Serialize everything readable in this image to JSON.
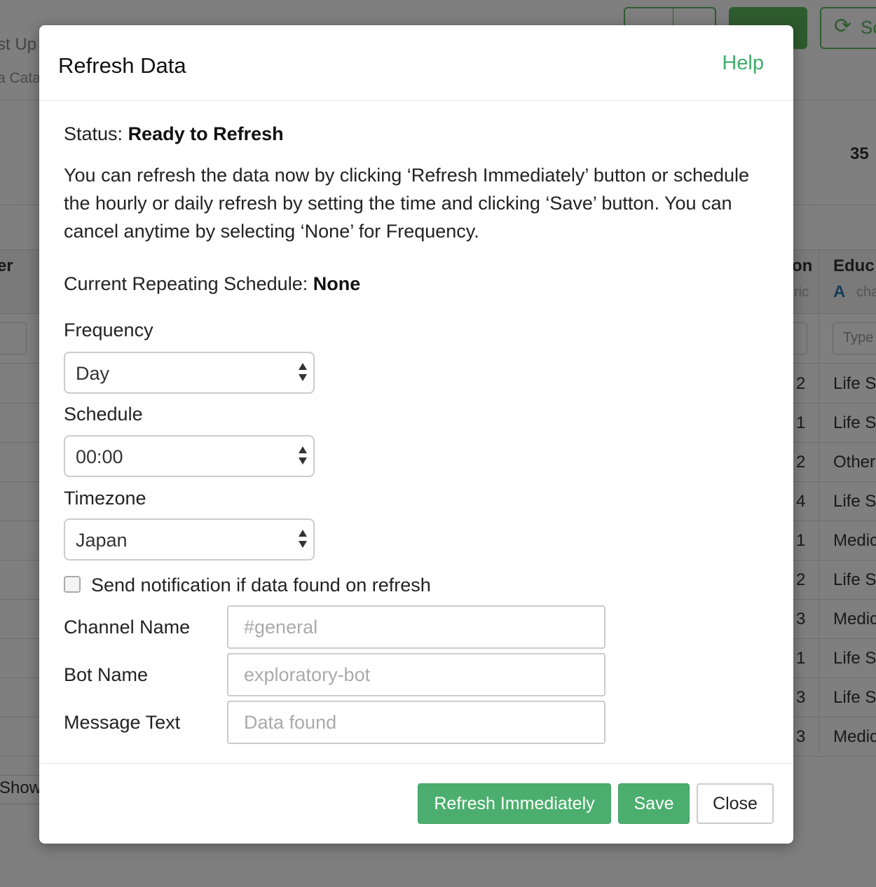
{
  "background": {
    "partial_texts": [
      "st Up",
      "a Cata",
      "35",
      "er",
      "on",
      "Educ",
      "ric",
      "A",
      "cha",
      "Type",
      "Show"
    ],
    "rows": [
      {
        "num": "2",
        "cat": "Life S"
      },
      {
        "num": "1",
        "cat": "Life S"
      },
      {
        "num": "2",
        "cat": "Other"
      },
      {
        "num": "4",
        "cat": "Life S"
      },
      {
        "num": "1",
        "cat": "Medic"
      },
      {
        "num": "2",
        "cat": "Life S"
      },
      {
        "num": "3",
        "cat": "Medic"
      },
      {
        "num": "1",
        "cat": "Life S"
      },
      {
        "num": "3",
        "cat": "Life S"
      },
      {
        "num": "3",
        "cat": "Medic"
      }
    ],
    "top_button_partial": "Sc",
    "colors": {
      "accent": "#5cb85c",
      "col_type_icon": "#337ab7"
    }
  },
  "modal": {
    "title": "Refresh Data",
    "help_label": "Help",
    "status_label": "Status:",
    "status_value": "Ready to Refresh",
    "description": "You can refresh the data now by clicking ‘Refresh Immediately’ button or schedule the hourly or daily refresh by setting the time and clicking ‘Save’ button. You can cancel anytime by selecting ‘None’ for Frequency.",
    "current_schedule_label": "Current Repeating Schedule:",
    "current_schedule_value": "None",
    "frequency": {
      "label": "Frequency",
      "value": "Day"
    },
    "schedule": {
      "label": "Schedule",
      "value": "00:00"
    },
    "timezone": {
      "label": "Timezone",
      "value": "Japan"
    },
    "notification": {
      "label": "Send notification if data found on refresh",
      "checked": false
    },
    "channel_name": {
      "label": "Channel Name",
      "placeholder": "#general"
    },
    "bot_name": {
      "label": "Bot Name",
      "placeholder": "exploratory-bot"
    },
    "message_text": {
      "label": "Message Text",
      "placeholder": "Data found"
    },
    "buttons": {
      "refresh_immediately": "Refresh Immediately",
      "save": "Save",
      "close": "Close"
    },
    "colors": {
      "primary": "#4cae6e",
      "help_link": "#3fae6b"
    }
  }
}
